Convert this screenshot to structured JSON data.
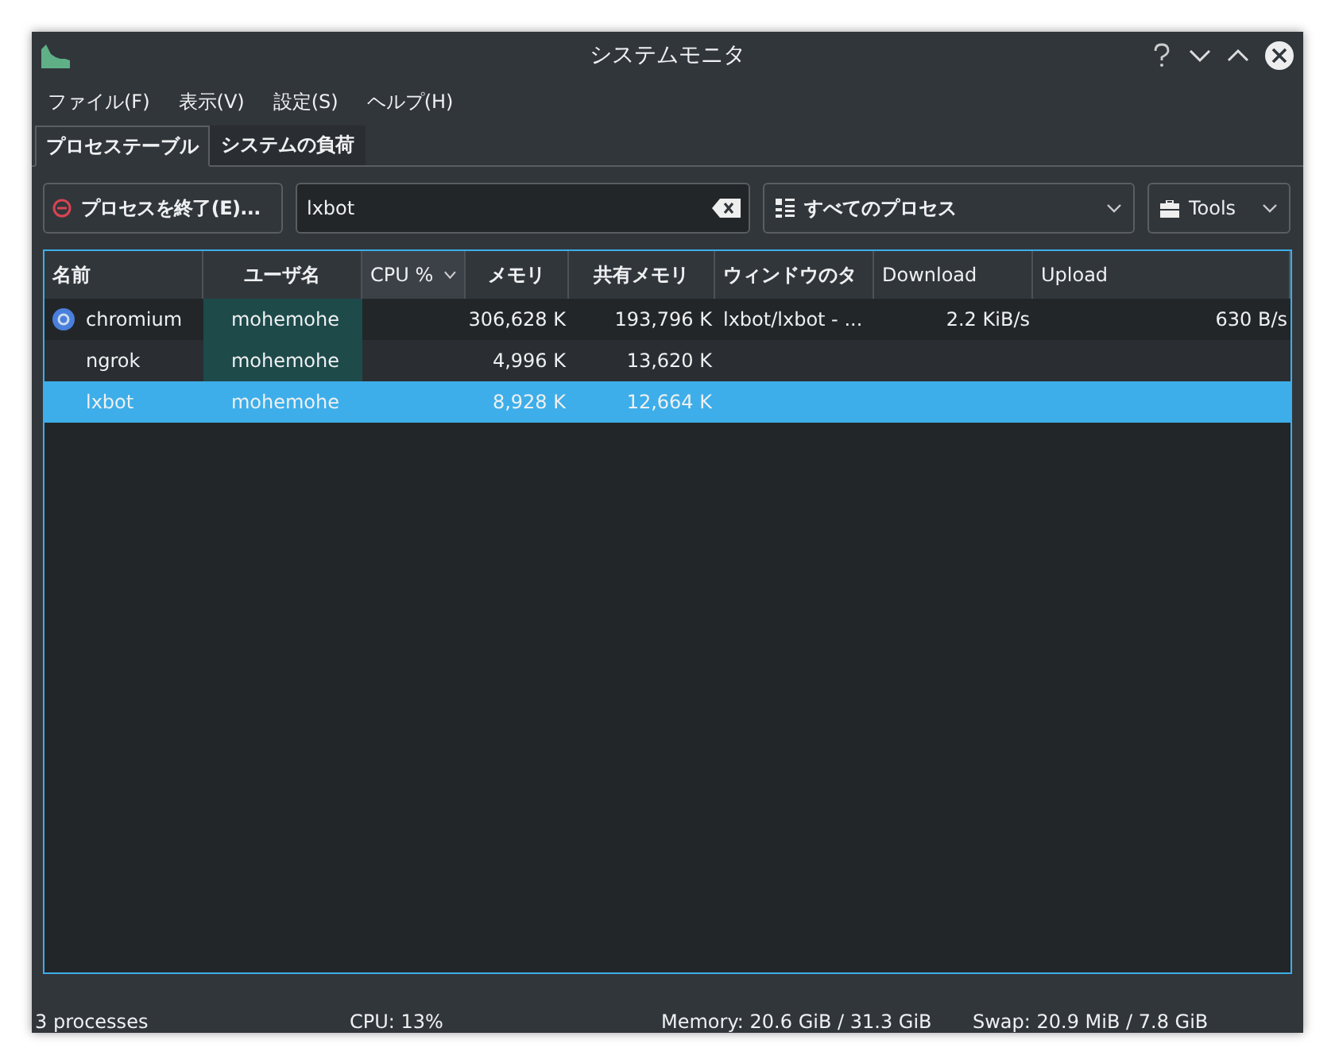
{
  "window": {
    "title": "システムモニタ"
  },
  "menu": [
    "ファイル(F)",
    "表示(V)",
    "設定(S)",
    "ヘルプ(H)"
  ],
  "tabs": [
    {
      "label": "プロセステーブル",
      "selected": true
    },
    {
      "label": "システムの負荷",
      "selected": false
    }
  ],
  "toolbar": {
    "kill_button": "プロセスを終了(E)...",
    "search": {
      "value": "lxbot"
    },
    "filter": "すべてのプロセス",
    "tools": "Tools"
  },
  "table": {
    "columns": [
      {
        "label": "名前",
        "sorted": false
      },
      {
        "label": "ユーザ名",
        "sorted": false
      },
      {
        "label": "CPU %",
        "sorted": true
      },
      {
        "label": "メモリ",
        "sorted": false
      },
      {
        "label": "共有メモリ",
        "sorted": false
      },
      {
        "label": "ウィンドウのタ",
        "sorted": false
      },
      {
        "label": "Download",
        "sorted": false
      },
      {
        "label": "Upload",
        "sorted": false
      }
    ],
    "rows": [
      {
        "name": "chromium",
        "has_icon": true,
        "user": "mohemohe",
        "own_user": true,
        "memory": "306,628 K",
        "shared": "193,796 K",
        "window": "lxbot/lxbot - ...",
        "download": "2.2 KiB/s",
        "upload": "630 B/s",
        "selected": false
      },
      {
        "name": "ngrok",
        "has_icon": false,
        "user": "mohemohe",
        "own_user": true,
        "memory": "4,996 K",
        "shared": "13,620 K",
        "selected": false
      },
      {
        "name": "lxbot",
        "has_icon": false,
        "user": "mohemohe",
        "own_user": true,
        "memory": "8,928 K",
        "shared": "12,664 K",
        "selected": true
      }
    ]
  },
  "status_bar": {
    "processes": "3 processes",
    "cpu": "CPU: 13%",
    "memory": "Memory: 20.6 GiB / 31.3 GiB",
    "swap": "Swap: 20.9 MiB / 7.8 GiB"
  }
}
